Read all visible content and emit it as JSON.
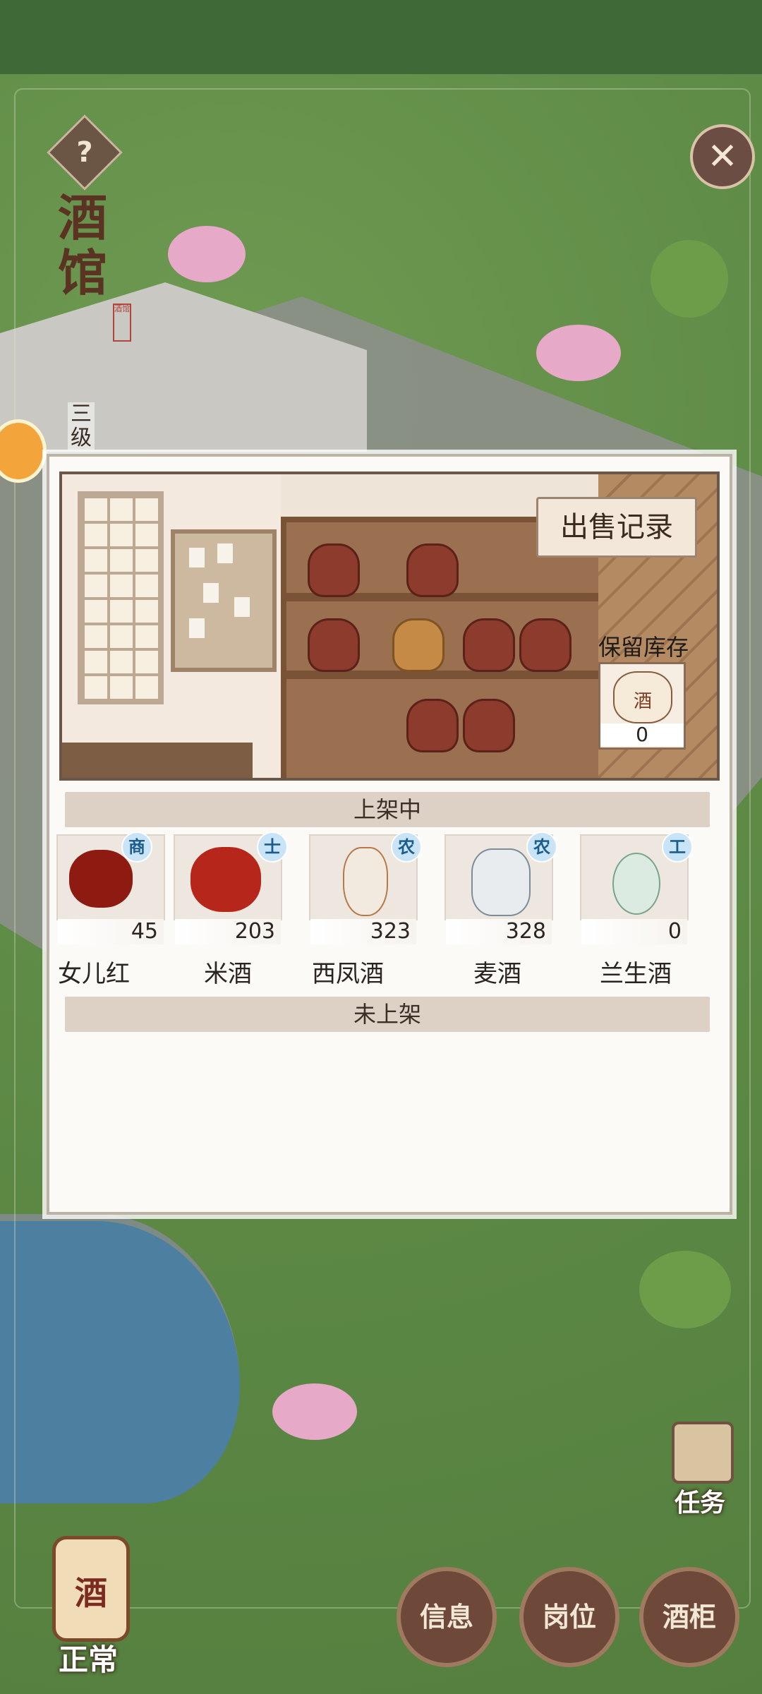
{
  "header": {
    "help_icon": "?",
    "close_icon": "✕",
    "tavern_title": "酒馆",
    "seal_text": "酒馆",
    "level_text": "三级"
  },
  "panel": {
    "sales_record_label": "出售记录",
    "reserve": {
      "label": "保留库存",
      "item_glyph": "酒",
      "count": "0"
    },
    "on_shelf_title": "上架中",
    "off_shelf_title": "未上架",
    "on_shelf_items": [
      {
        "name": "女儿红",
        "count": "45",
        "tier": "商",
        "color": "#8d1b12"
      },
      {
        "name": "米酒",
        "count": "203",
        "tier": "士",
        "color": "#b7261b"
      },
      {
        "name": "西凤酒",
        "count": "323",
        "tier": "农",
        "color": "#f3eadf"
      },
      {
        "name": "麦酒",
        "count": "328",
        "tier": "农",
        "color": "#e8ecef"
      },
      {
        "name": "兰生酒",
        "count": "0",
        "tier": "工",
        "color": "#dcebe2"
      }
    ]
  },
  "bottom": {
    "status_glyph": "酒",
    "status_label": "正常",
    "task_label": "任务",
    "buttons": [
      "信息",
      "岗位",
      "酒柜"
    ]
  }
}
